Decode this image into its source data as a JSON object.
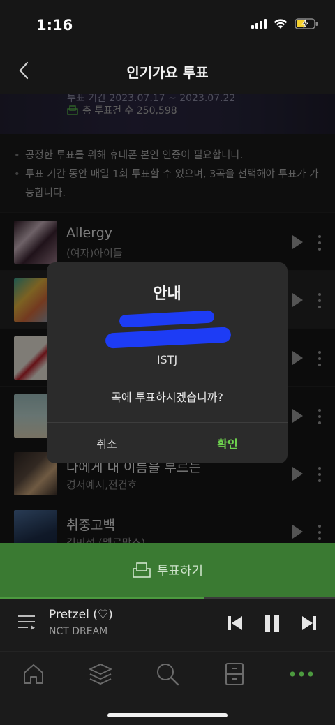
{
  "status_bar": {
    "time": "1:16"
  },
  "header": {
    "title": "인기가요 투표",
    "back_icon": "chevron-left-icon"
  },
  "banner": {
    "period": "투표 기간 2023.07.17 ~ 2023.07.22",
    "total_votes": "총 투표건 수 250,598"
  },
  "notice": {
    "items": [
      "공정한 투표를 위해 휴대폰 본인 인증이 필요합니다.",
      "투표 기간 동안 매일 1회 투표할 수 있으며, 3곡을 선택해야 투표가 가능합니다."
    ]
  },
  "songs": [
    {
      "title": "Allergy",
      "artist": "(여자)아이들",
      "art_colors": [
        "#3a2230",
        "#c9b3bd"
      ]
    },
    {
      "title": "",
      "artist": "",
      "art_colors": [
        "#d26a3b",
        "#3aa08f"
      ]
    },
    {
      "title": "",
      "artist": "",
      "art_colors": [
        "#e8e2d8",
        "#b8202a"
      ]
    },
    {
      "title": "",
      "artist": "",
      "art_colors": [
        "#9fbfbe",
        "#d9d0b6"
      ]
    },
    {
      "title": "나에게 내 이름을 부르는",
      "artist": "경서예지,전건호",
      "art_colors": [
        "#5b4a3e",
        "#cba57a"
      ]
    },
    {
      "title": "취중고백",
      "artist": "김민석 (멜로망스)",
      "art_colors": [
        "#1d2e4a",
        "#4a6c99"
      ]
    }
  ],
  "vote_button": {
    "label": "투표하기"
  },
  "player": {
    "title": "Pretzel (♡)",
    "artist": "NCT DREAM",
    "progress": 0.61
  },
  "tabs": [
    "home-icon",
    "library-icon",
    "search-icon",
    "storage-icon",
    "more-icon"
  ],
  "dialog": {
    "title": "안내",
    "song_line": "ISTJ",
    "question": "곡에 투표하시겠습니까?",
    "cancel_label": "취소",
    "confirm_label": "확인"
  },
  "colors": {
    "accent_green": "#6fd34f",
    "vote_bar": "#3a7a32",
    "redaction": "#1d3cf5"
  }
}
